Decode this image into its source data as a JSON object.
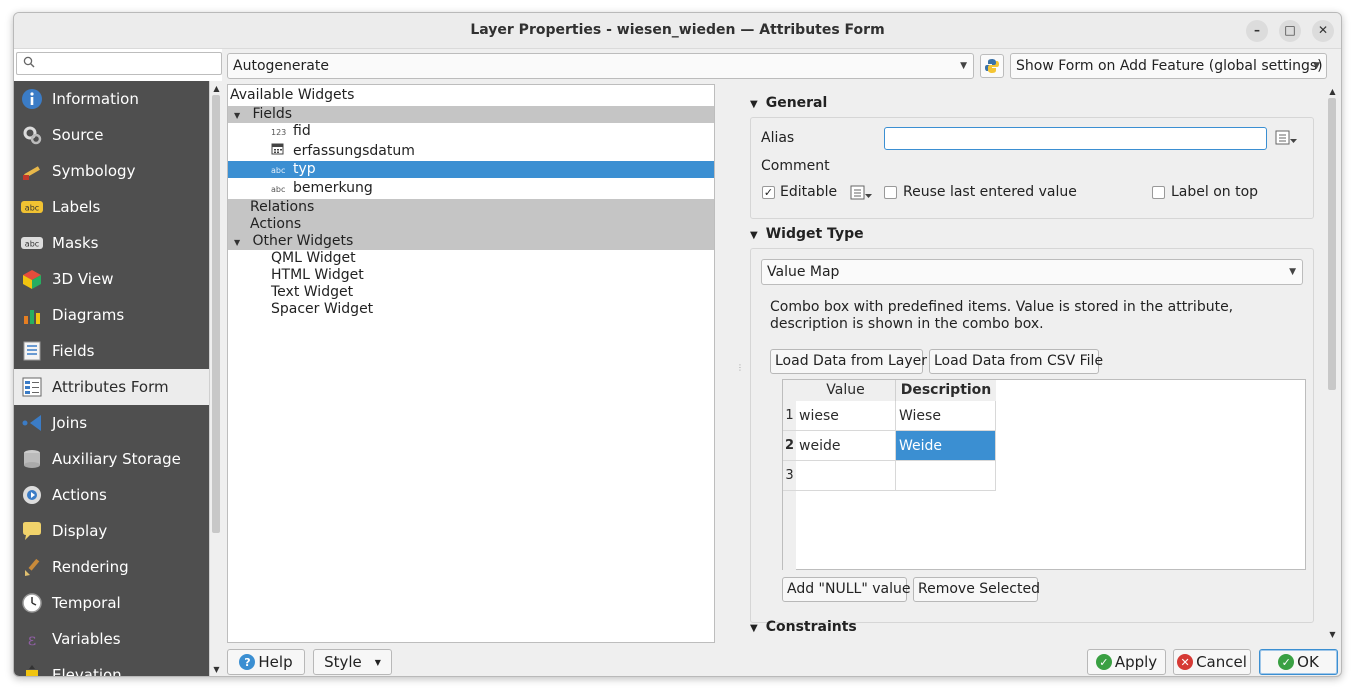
{
  "window": {
    "title": "Layer Properties - wiesen_wieden — Attributes Form",
    "minimize": "–",
    "maximize": "□",
    "close": "✕"
  },
  "search": {
    "placeholder": ""
  },
  "sidebar": {
    "items": [
      {
        "label": "Information",
        "icon": "info-icon"
      },
      {
        "label": "Source",
        "icon": "source-icon"
      },
      {
        "label": "Symbology",
        "icon": "symbology-icon"
      },
      {
        "label": "Labels",
        "icon": "labels-icon"
      },
      {
        "label": "Masks",
        "icon": "masks-icon"
      },
      {
        "label": "3D View",
        "icon": "3d-view-icon"
      },
      {
        "label": "Diagrams",
        "icon": "diagrams-icon"
      },
      {
        "label": "Fields",
        "icon": "fields-icon"
      },
      {
        "label": "Attributes Form",
        "icon": "attributes-form-icon",
        "active": true
      },
      {
        "label": "Joins",
        "icon": "joins-icon"
      },
      {
        "label": "Auxiliary Storage",
        "icon": "auxiliary-storage-icon"
      },
      {
        "label": "Actions",
        "icon": "actions-icon"
      },
      {
        "label": "Display",
        "icon": "display-icon"
      },
      {
        "label": "Rendering",
        "icon": "rendering-icon"
      },
      {
        "label": "Temporal",
        "icon": "temporal-icon"
      },
      {
        "label": "Variables",
        "icon": "variables-icon"
      },
      {
        "label": "Elevation",
        "icon": "elevation-icon"
      }
    ]
  },
  "toolbar": {
    "layout_mode": "Autogenerate",
    "show_form": "Show Form on Add Feature (global settings)"
  },
  "tree": {
    "header": "Available Widgets",
    "fields_group": "Fields",
    "fields": [
      {
        "type": "123",
        "name": "fid"
      },
      {
        "type": "cal",
        "name": "erfassungsdatum"
      },
      {
        "type": "abc",
        "name": "typ",
        "selected": true
      },
      {
        "type": "abc",
        "name": "bemerkung"
      }
    ],
    "relations_group": "Relations",
    "actions_group": "Actions",
    "other_group": "Other Widgets",
    "other": [
      "QML Widget",
      "HTML Widget",
      "Text Widget",
      "Spacer Widget"
    ]
  },
  "general": {
    "title": "General",
    "alias_label": "Alias",
    "alias_value": "",
    "comment_label": "Comment",
    "editable_label": "Editable",
    "editable_checked": true,
    "reuse_label": "Reuse last entered value",
    "reuse_checked": false,
    "label_on_top": "Label on top",
    "label_on_top_checked": false
  },
  "widget_type": {
    "title": "Widget Type",
    "selected": "Value Map",
    "description": "Combo box with predefined items. Value is stored in the attribute, description is shown in the combo box.",
    "load_layer": "Load Data from Layer",
    "load_csv": "Load Data from CSV File",
    "col_value": "Value",
    "col_description": "Description",
    "rows": [
      {
        "num": "1",
        "value": "wiese",
        "description": "Wiese"
      },
      {
        "num": "2",
        "value": "weide",
        "description": "Weide"
      },
      {
        "num": "3",
        "value": "",
        "description": ""
      }
    ],
    "add_null": "Add \"NULL\" value",
    "remove_selected": "Remove Selected"
  },
  "constraints": {
    "title": "Constraints"
  },
  "bottom": {
    "help": "Help",
    "style": "Style",
    "apply": "Apply",
    "cancel": "Cancel",
    "ok": "OK"
  },
  "colors": {
    "accent": "#3b8fd2",
    "nav_bg": "#4f4f4f",
    "group_bg": "#c5c5c5"
  }
}
